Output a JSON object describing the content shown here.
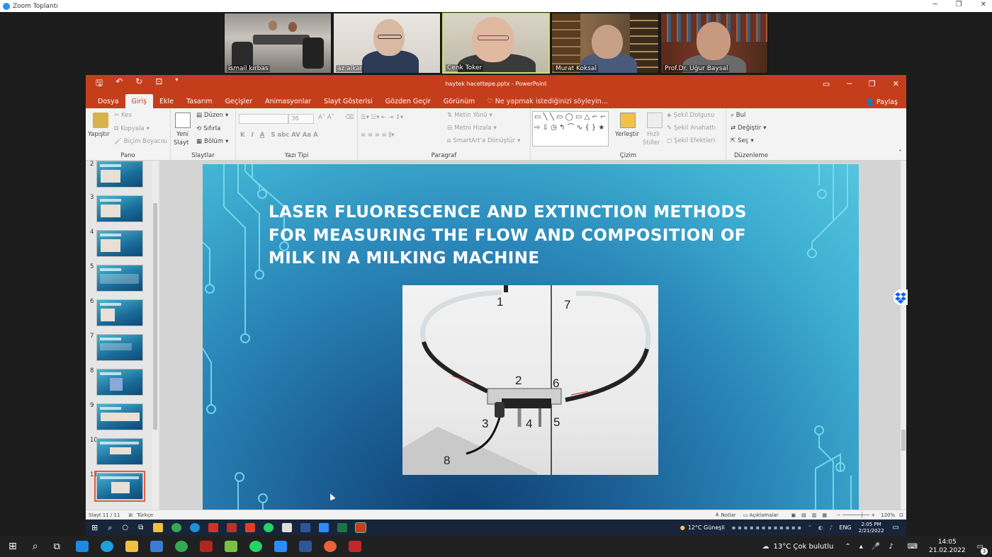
{
  "zoom": {
    "title": "Zoom Toplantı",
    "participants": [
      {
        "name": "ismail kirbas"
      },
      {
        "name": "az alkar"
      },
      {
        "name": "Cenk Toker"
      },
      {
        "name": "Murat Koksal"
      },
      {
        "name": "Prof.Dr. Uğur Baysal"
      }
    ]
  },
  "ppt": {
    "doc_title": "haytek hacettepe.pptx - PowerPoint",
    "tabs": [
      "Dosya",
      "Giriş",
      "Ekle",
      "Tasarım",
      "Geçişler",
      "Animasyonlar",
      "Slayt Gösterisi",
      "Gözden Geçir",
      "Görünüm"
    ],
    "selected_tab": "Giriş",
    "tell_me": "Ne yapmak istediğinizi söyleyin...",
    "share": "Paylaş",
    "ribbon": {
      "pano": {
        "label": "Pano",
        "paste": "Yapıştır",
        "cut": "Kes",
        "copy": "Kopyala",
        "format_painter": "Biçim Boyacısı"
      },
      "slaytlar": {
        "label": "Slaytlar",
        "new_slide": "Yeni",
        "new_slide2": "Slayt",
        "layout": "Düzen",
        "reset": "Sıfırla",
        "section": "Bölüm"
      },
      "yazitipi": {
        "label": "Yazı Tipi",
        "font_size": "36"
      },
      "paragraf": {
        "label": "Paragraf",
        "text_direction": "Metin Yönü",
        "align_text": "Metni Hizala",
        "smartart": "SmartArt'a Dönüştür"
      },
      "cizim": {
        "label": "Çizim",
        "arrange": "Yerleştir",
        "quick_styles": "Hızlı",
        "quick_styles2": "Stiller",
        "shape_fill": "Şekil Dolgusu",
        "shape_outline": "Şekil Anahattı",
        "shape_effects": "Şekil Efektleri"
      },
      "duzenleme": {
        "label": "Düzenleme",
        "find": "Bul",
        "replace": "Değiştir",
        "select": "Seç"
      }
    },
    "slide_numbers": [
      "2",
      "3",
      "4",
      "5",
      "6",
      "7",
      "8",
      "9",
      "10",
      "11"
    ],
    "current_slide": "11",
    "slide": {
      "title": "LASER FLUORESCENCE AND EXTINCTION METHODS FOR MEASURING THE FLOW AND COMPOSITION OF MILK IN A MILKING MACHINE",
      "photo_labels": [
        "1",
        "7",
        "2",
        "6",
        "3",
        "4",
        "5",
        "8"
      ]
    },
    "status": {
      "slide_counter": "Slayt 11 / 11",
      "language": "Türkçe",
      "notes": "Notlar",
      "comments": "Açıklamalar",
      "zoom": "120%"
    }
  },
  "inner_taskbar": {
    "weather": "12°C  Güneşli",
    "lang": "ENG",
    "time": "2:05 PM",
    "date": "2/21/2022"
  },
  "outer_taskbar": {
    "weather": "13°C  Çok bulutlu",
    "time": "14:05",
    "date": "21.02.2022",
    "notif_count": "3"
  },
  "colors": {
    "ppt_accent": "#c43e1c",
    "taskbar": "#202020",
    "slide_blue": "#2a86b8"
  }
}
